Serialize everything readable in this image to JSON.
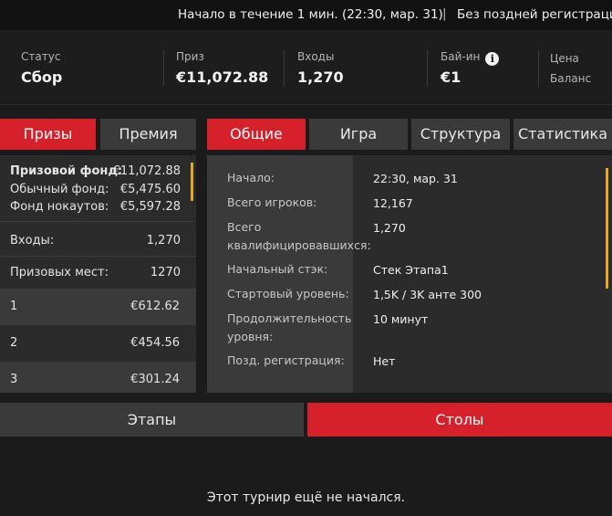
{
  "topbar": {
    "start_text": "Начало в течение 1 мин. (22:30, мар. 31)",
    "separator": "|",
    "late_reg": "Без поздней регистрации"
  },
  "info": {
    "status_label": "Статус",
    "status_value": "Сбор",
    "prize_label": "Приз",
    "prize_value": "€11,072.88",
    "entries_label": "Входы",
    "entries_value": "1,270",
    "buyin_label": "Бай-ин",
    "buyin_value": "€1",
    "price_label": "Цена",
    "balance_label": "Баланс"
  },
  "left_tabs": [
    "Призы",
    "Премия"
  ],
  "right_tabs": [
    "Общие",
    "Игра",
    "Структура",
    "Статистика"
  ],
  "prizes": {
    "pool_label": "Призовой фонд:",
    "pool_value": "€11,072.88",
    "regular_label": "Обычный фонд:",
    "regular_value": "€5,475.60",
    "knockout_label": "Фонд нокаутов:",
    "knockout_value": "€5,597.28",
    "entries_label": "Входы:",
    "entries_value": "1,270",
    "places_label": "Призовых мест:",
    "places_value": "1270",
    "places": [
      {
        "place": "1",
        "amount": "€612.62"
      },
      {
        "place": "2",
        "amount": "€454.56"
      },
      {
        "place": "3",
        "amount": "€301.24"
      }
    ]
  },
  "general": {
    "start_label": "Начало:",
    "start_value": "22:30, мар. 31",
    "players_label": "Всего игроков:",
    "players_value": "12,167",
    "qualified_label": "Всего квалифицировавшихся:",
    "qualified_value": "1,270",
    "stack_label": "Начальный стэк:",
    "stack_value": "Стек Этапа1",
    "level_label": "Стартовый уровень:",
    "level_value": "1,5K / 3K анте 300",
    "duration_label": "Продолжительность уровня:",
    "duration_value": "10 минут",
    "latereg_label": "Позд. регистрация:",
    "latereg_value": "Нет"
  },
  "bottom_tabs": {
    "stages": "Этапы",
    "tables": "Столы"
  },
  "notice": "Этот турнир ещё не начался.",
  "colors": {
    "accent": "#d6202a",
    "scroll": "#e6a81e"
  }
}
